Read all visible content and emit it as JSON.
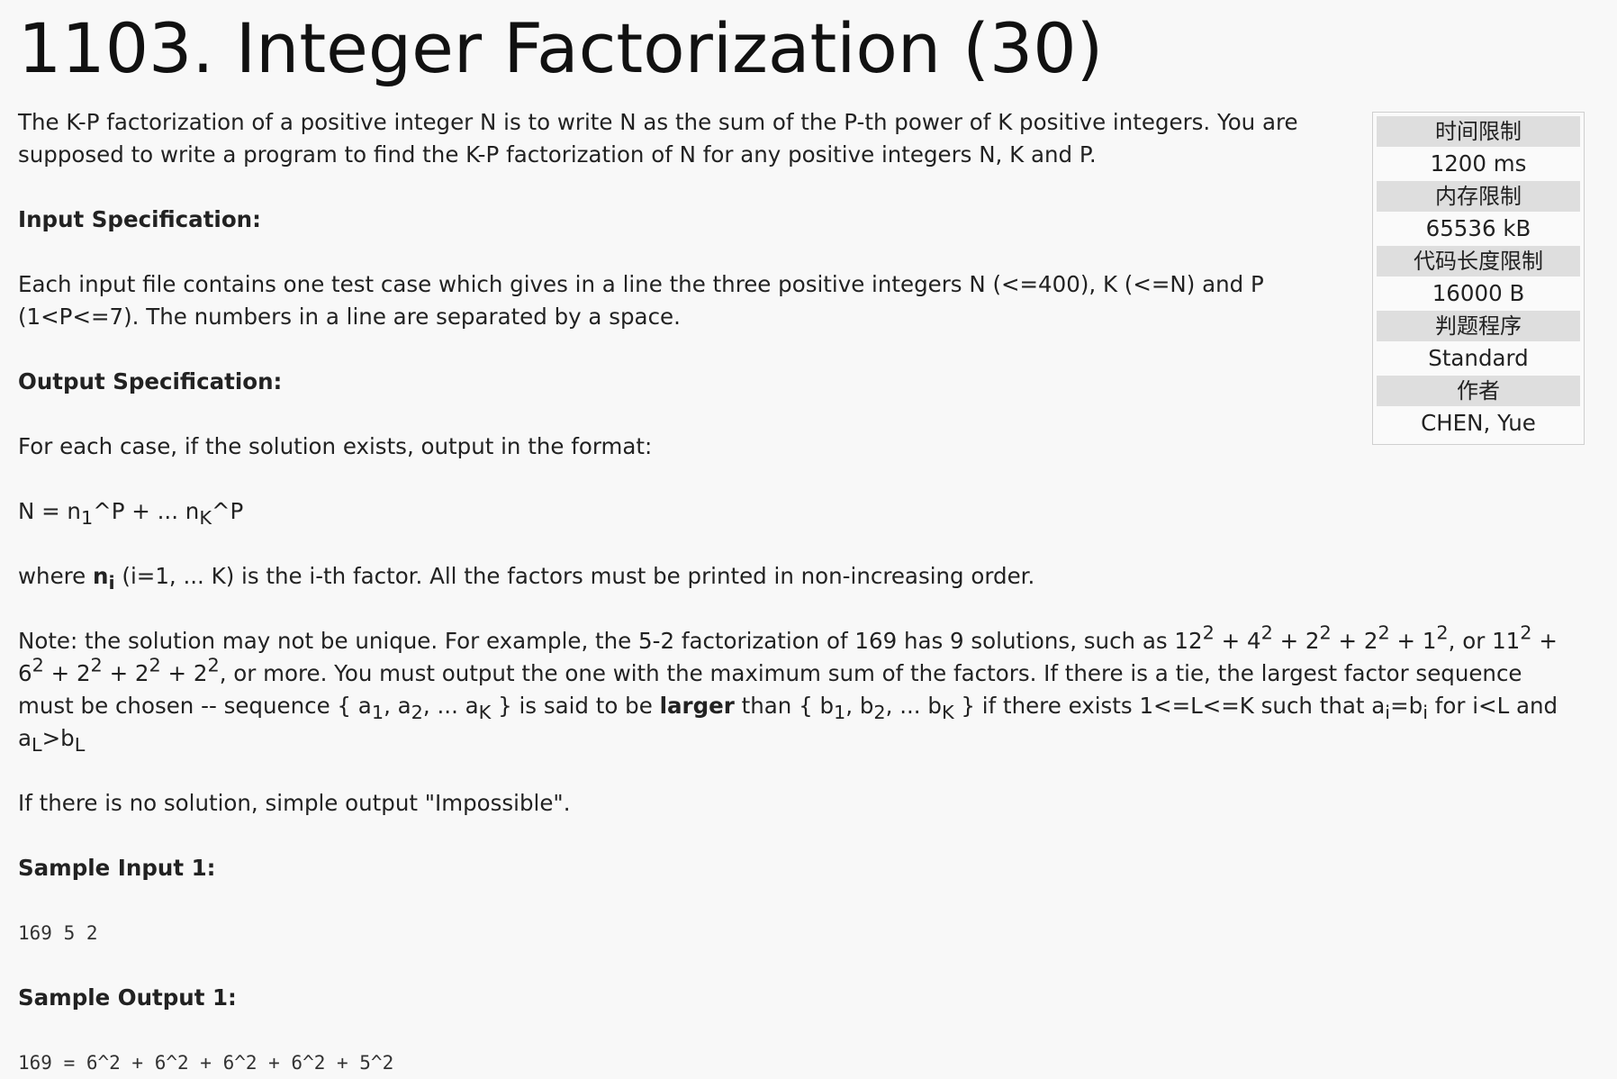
{
  "title": "1103. Integer Factorization (30)",
  "intro": "The K-P factorization of a positive integer N is to write N as the sum of the P-th power of K positive integers. You are supposed to write a program to find the K-P factorization of N for any positive integers N, K and P.",
  "input_spec": {
    "heading": "Input Specification:",
    "body": "Each input file contains one test case which gives in a line the three positive integers N (<=400), K (<=N) and P (1<P<=7). The numbers in a line are separated by a space."
  },
  "output_spec": {
    "heading": "Output Specification:",
    "format_line": "For each case, if the solution exists, output in the format:",
    "format": {
      "a": "N = n",
      "b": "1",
      "c": "^P + ... n",
      "d": "K",
      "e": "^P"
    },
    "where": {
      "a": "where ",
      "b": "n",
      "c": "i",
      "d": " (i=1, ... K) is the i-th factor. All the factors must be printed in non-increasing order."
    },
    "note": {
      "t1": "Note: the solution may not be unique. For example, the 5-2 factorization of 169 has 9 solutions, such as 12",
      "s1": "2",
      "t2": " + 4",
      "s2": "2",
      "t3": " + 2",
      "s3": "2",
      "t4": " + 2",
      "s4": "2",
      "t5": " + 1",
      "s5": "2",
      "t6": ", or 11",
      "s6": "2",
      "t7": " + 6",
      "s7": "2",
      "t8": " + 2",
      "s8": "2",
      "t9": " + 2",
      "s9": "2",
      "t10": " + 2",
      "s10": "2",
      "t11": ", or more. You must output the one with the maximum sum of the factors. If there is a tie, the largest factor sequence must be chosen -- sequence { a",
      "b1": "1",
      "t12": ", a",
      "b2": "2",
      "t13": ", ... a",
      "b3": "K",
      "t14": " } is said to be ",
      "bold": "larger",
      "t15": " than { b",
      "b4": "1",
      "t16": ", b",
      "b5": "2",
      "t17": ", ... b",
      "b6": "K",
      "t18": " } if there exists 1<=L<=K such that a",
      "b7": "i",
      "t19": "=b",
      "b8": "i",
      "t20": " for i<L and a",
      "b9": "L",
      "t21": ">b",
      "b10": "L"
    },
    "impossible": "If there is no solution, simple output \"Impossible\"."
  },
  "sample_input": {
    "heading": "Sample Input 1:",
    "text": "169 5 2"
  },
  "sample_output": {
    "heading": "Sample Output 1:",
    "text": "169 = 6^2 + 6^2 + 6^2 + 6^2 + 5^2"
  },
  "limits": [
    {
      "label": "时间限制",
      "value": "1200 ms"
    },
    {
      "label": "内存限制",
      "value": "65536 kB"
    },
    {
      "label": "代码长度限制",
      "value": "16000 B"
    },
    {
      "label": "判题程序",
      "value": "Standard"
    },
    {
      "label": "作者",
      "value": "CHEN, Yue"
    }
  ]
}
